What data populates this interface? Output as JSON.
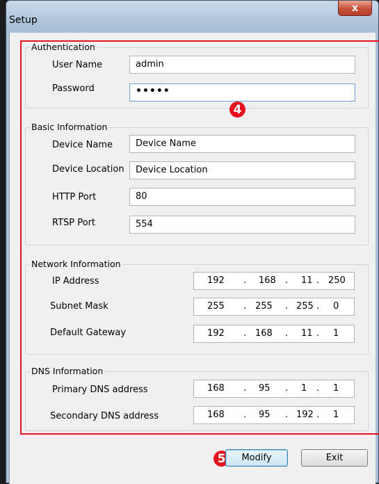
{
  "window": {
    "title": "Setup",
    "close_label": "x"
  },
  "authentication": {
    "title": "Authentication",
    "user_name_label": "User Name",
    "user_name_value": "admin",
    "password_label": "Password",
    "password_value": "•••••"
  },
  "basic": {
    "title": "Basic Information",
    "device_name_label": "Device Name",
    "device_name_value": "Device Name",
    "device_location_label": "Device Location",
    "device_location_value": "Device Location",
    "http_port_label": "HTTP Port",
    "http_port_value": "80",
    "rtsp_port_label": "RTSP Port",
    "rtsp_port_value": "554"
  },
  "network": {
    "title": "Network Information",
    "ip_label": "IP Address",
    "ip": [
      "192",
      "168",
      "11",
      "250"
    ],
    "subnet_label": "Subnet Mask",
    "subnet": [
      "255",
      "255",
      "255",
      "0"
    ],
    "gateway_label": "Default Gateway",
    "gateway": [
      "192",
      "168",
      "11",
      "1"
    ]
  },
  "dns": {
    "title": "DNS Information",
    "primary_label": "Primary DNS address",
    "primary": [
      "168",
      "95",
      "1",
      "1"
    ],
    "secondary_label": "Secondary DNS address",
    "secondary": [
      "168",
      "95",
      "192",
      "1"
    ]
  },
  "badges": {
    "badge_4": "4",
    "badge_5": "5"
  },
  "buttons": {
    "modify": "Modify",
    "exit": "Exit"
  },
  "colors": {
    "highlight": "#e8101c",
    "titlebar": "#a9bfd6",
    "close": "#c7503a"
  }
}
